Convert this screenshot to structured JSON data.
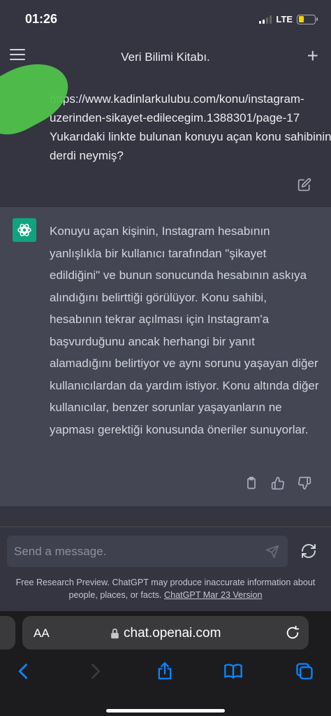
{
  "status_bar": {
    "time": "01:26",
    "network": "LTE",
    "battery_level": 0.35,
    "battery_color": "#f5d300"
  },
  "header": {
    "title": "Veri Bilimi Kitabı."
  },
  "user_message": {
    "text": "https://www.kadinlarkulubu.com/konu/instagram-uzerinden-sikayet-edilecegim.1388301/page-17\nYukarıdaki linkte bulunan konuyu açan konu sahibinin derdi neymiş?"
  },
  "assistant_message": {
    "text": "Konuyu açan kişinin, Instagram hesabının yanlışlıkla bir kullanıcı tarafından \"şikayet edildiğini\" ve bunun sonucunda hesabının askıya alındığını belirttiği görülüyor. Konu sahibi, hesabının tekrar açılması için Instagram'a başvurduğunu ancak herhangi bir yanıt alamadığını belirtiyor ve aynı sorunu yaşayan diğer kullanıcılardan da yardım istiyor. Konu altında diğer kullanıcılar, benzer sorunlar yaşayanların ne yapması gerektiği konusunda öneriler sunuyorlar."
  },
  "composer": {
    "placeholder": "Send a message.",
    "disclaimer": "Free Research Preview. ChatGPT may produce inaccurate information about people, places, or facts.",
    "version_link": "ChatGPT Mar 23 Version"
  },
  "browser": {
    "aa_label": "AA",
    "url": "chat.openai.com"
  },
  "colors": {
    "accent": "#10a37f",
    "safari_blue": "#0a84ff"
  }
}
